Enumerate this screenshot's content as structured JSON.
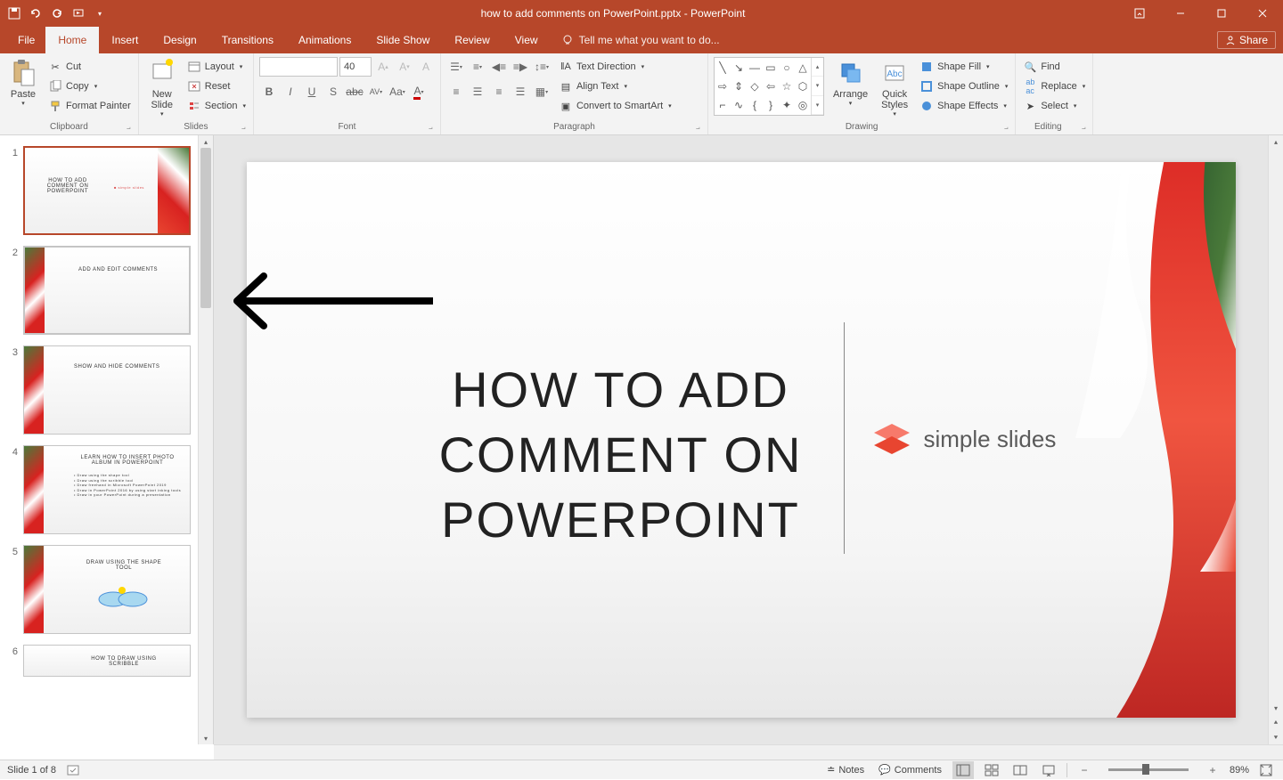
{
  "titlebar": {
    "title": "how to add comments on PowerPoint.pptx - PowerPoint"
  },
  "tabs": {
    "file": "File",
    "home": "Home",
    "insert": "Insert",
    "design": "Design",
    "transitions": "Transitions",
    "animations": "Animations",
    "slideshow": "Slide Show",
    "review": "Review",
    "view": "View",
    "tellme": "Tell me what you want to do...",
    "share": "Share"
  },
  "ribbon": {
    "clipboard": {
      "label": "Clipboard",
      "paste": "Paste",
      "cut": "Cut",
      "copy": "Copy",
      "format_painter": "Format Painter"
    },
    "slides": {
      "label": "Slides",
      "new_slide": "New\nSlide",
      "layout": "Layout",
      "reset": "Reset",
      "section": "Section"
    },
    "font": {
      "label": "Font",
      "size": "40"
    },
    "paragraph": {
      "label": "Paragraph",
      "text_direction": "Text Direction",
      "align_text": "Align Text",
      "convert_smartart": "Convert to SmartArt"
    },
    "drawing": {
      "label": "Drawing",
      "arrange": "Arrange",
      "quick_styles": "Quick\nStyles",
      "shape_fill": "Shape Fill",
      "shape_outline": "Shape Outline",
      "shape_effects": "Shape Effects"
    },
    "editing": {
      "label": "Editing",
      "find": "Find",
      "replace": "Replace",
      "select": "Select"
    }
  },
  "thumbnails": [
    {
      "num": "1",
      "title": "HOW TO ADD COMMENT ON POWERPOINT"
    },
    {
      "num": "2",
      "title": "ADD AND EDIT COMMENTS"
    },
    {
      "num": "3",
      "title": "SHOW AND HIDE COMMENTS"
    },
    {
      "num": "4",
      "title": "LEARN HOW TO INSERT PHOTO ALBUM IN POWERPOINT"
    },
    {
      "num": "5",
      "title": "DRAW USING THE SHAPE TOOL"
    },
    {
      "num": "6",
      "title": "HOW TO DRAW USING SCRIBBLE"
    }
  ],
  "slide": {
    "title": "HOW TO ADD COMMENT ON POWERPOINT",
    "logo_text": "simple slides"
  },
  "statusbar": {
    "slide_indicator": "Slide 1 of 8",
    "notes": "Notes",
    "comments": "Comments",
    "zoom": "89%"
  }
}
